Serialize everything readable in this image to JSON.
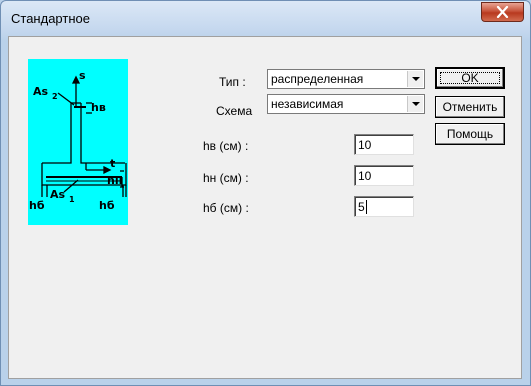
{
  "window": {
    "title": "Стандартное"
  },
  "diagram": {
    "labels": {
      "s": "s",
      "as2": "As",
      "as2_sub": "2",
      "hv": "hв",
      "t": "t",
      "hn": "hн",
      "as1": "As",
      "as1_sub": "1",
      "hb_left": "hб",
      "hb_right": "hб"
    },
    "background_color": "#00ffff"
  },
  "form": {
    "type_label": "Тип :",
    "type_value": "распределенная",
    "scheme_label": "Схема",
    "scheme_value": "независимая",
    "hv_label": "hв (см) :",
    "hv_value": "10",
    "hn_label": "hн (см) :",
    "hn_value": "10",
    "hb_label": "hб (см) :",
    "hb_value": "5"
  },
  "buttons": {
    "ok": "OK",
    "cancel": "Отменить",
    "help": "Помощь"
  }
}
